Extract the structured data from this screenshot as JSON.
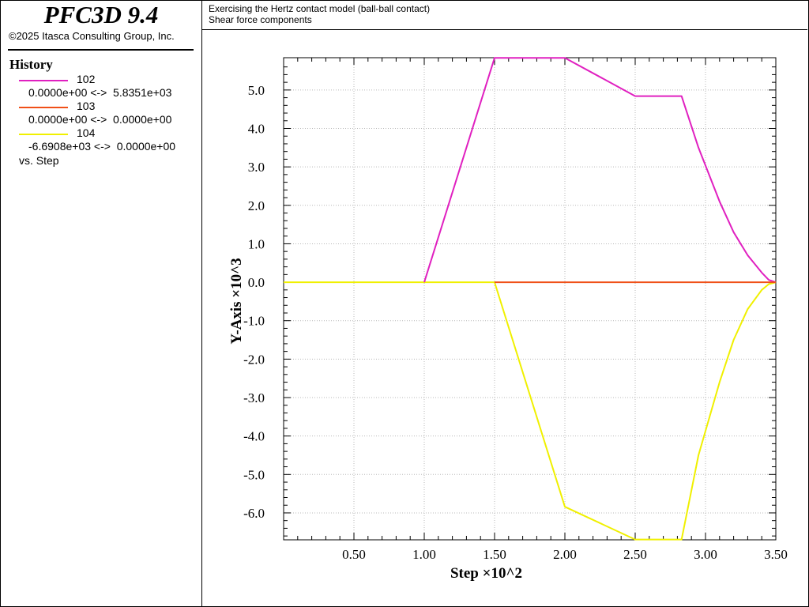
{
  "app": {
    "title": "PFC3D 9.4",
    "copyright": "©2025 Itasca Consulting Group, Inc."
  },
  "legend": {
    "heading": "History",
    "items": [
      {
        "id": "102",
        "range": "0.0000e+00 <->  5.8351e+03",
        "color": "#E020C0"
      },
      {
        "id": "103",
        "range": "0.0000e+00 <->  0.0000e+00",
        "color": "#F05018"
      },
      {
        "id": "104",
        "range": "-6.6908e+03 <->  0.0000e+00",
        "color": "#F0F000"
      }
    ],
    "vs": "vs. Step"
  },
  "plot": {
    "title": "Exercising the Hertz contact model (ball-ball contact)",
    "subtitle": "Shear force components"
  },
  "chart_data": {
    "type": "line",
    "xlabel": "Step ×10^2",
    "ylabel": "Y-Axis ×10^3",
    "xlim": [
      0,
      3.5
    ],
    "ylim": [
      -6.7,
      5.84
    ],
    "x_ticks": [
      "0.50",
      "1.00",
      "1.50",
      "2.00",
      "2.50",
      "3.00",
      "3.50"
    ],
    "y_ticks": [
      "5.0",
      "4.0",
      "3.0",
      "2.0",
      "1.0",
      "0.0",
      "-1.0",
      "-2.0",
      "-3.0",
      "-4.0",
      "-5.0",
      "-6.0"
    ],
    "grid": true,
    "series": [
      {
        "name": "102",
        "color": "#E020C0",
        "x": [
          1.0,
          1.5,
          2.0,
          2.5,
          2.83,
          2.95,
          3.1,
          3.2,
          3.3,
          3.4,
          3.45,
          3.5
        ],
        "y": [
          0.0,
          5.8351,
          5.8351,
          4.84,
          4.84,
          3.5,
          2.1,
          1.3,
          0.7,
          0.25,
          0.06,
          0.0
        ]
      },
      {
        "name": "103",
        "color": "#F05018",
        "x": [
          1.5,
          3.5
        ],
        "y": [
          0.0,
          0.0
        ]
      },
      {
        "name": "104",
        "color": "#F0F000",
        "x": [
          0.0,
          1.5,
          2.0,
          2.5,
          2.83,
          2.95,
          3.1,
          3.2,
          3.3,
          3.4,
          3.45,
          3.5
        ],
        "y": [
          0.0,
          0.0,
          -5.84,
          -6.6908,
          -6.6908,
          -4.5,
          -2.6,
          -1.5,
          -0.7,
          -0.2,
          -0.05,
          0.0
        ]
      }
    ]
  }
}
